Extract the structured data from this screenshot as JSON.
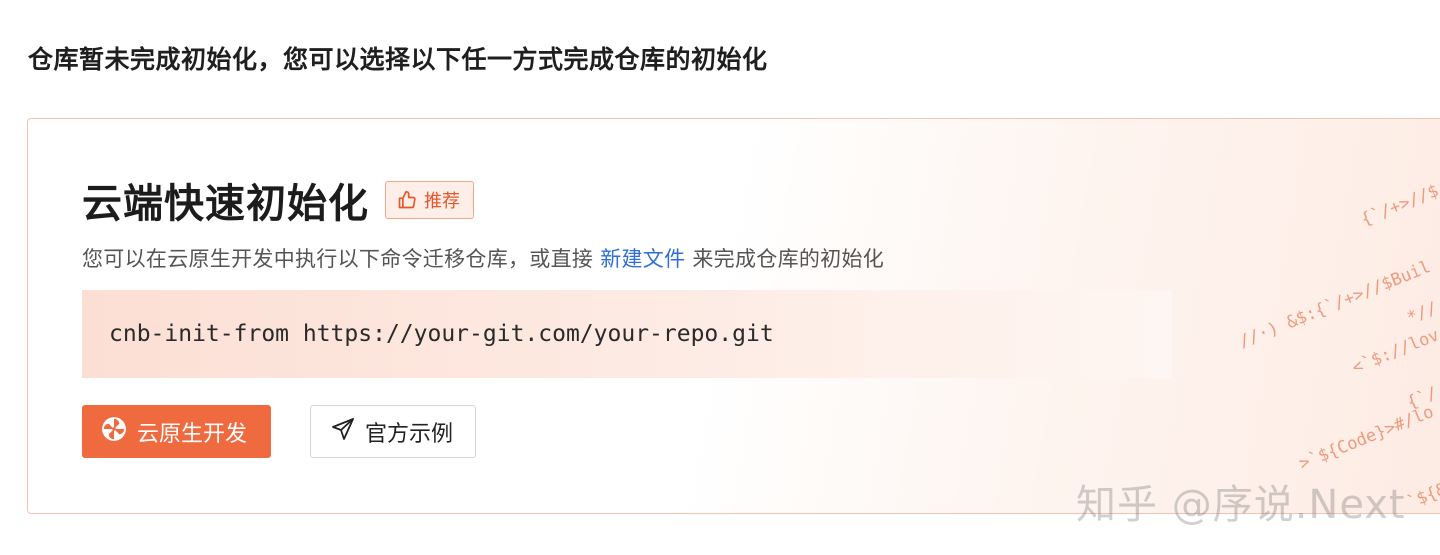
{
  "page": {
    "heading": "仓库暂未完成初始化，您可以选择以下任一方式完成仓库的初始化"
  },
  "card": {
    "title": "云端快速初始化",
    "badge": {
      "icon": "thumbs-up-icon",
      "label": "推荐"
    },
    "description": {
      "before": "您可以在云原生开发中执行以下命令迁移仓库，或直接",
      "link": "新建文件",
      "after": "来完成仓库的初始化"
    },
    "command": "cnb-init-from https://your-git.com/your-repo.git",
    "buttons": {
      "primary": {
        "icon": "pinwheel-icon",
        "label": "云原生开发"
      },
      "secondary": {
        "icon": "paper-plane-icon",
        "label": "官方示例"
      }
    },
    "decorative_code": [
      "{`/+>//$",
      "//·) &$:{`/+>//$Buil",
      "*//",
      "<`$://lov",
      "{`/",
      ">`${Code}>#/lo",
      "`${&"
    ]
  },
  "watermark": "知乎 @序说.Next",
  "colors": {
    "accent": "#f06a3f",
    "link": "#2f6fd6",
    "border": "#f2c4b2"
  }
}
